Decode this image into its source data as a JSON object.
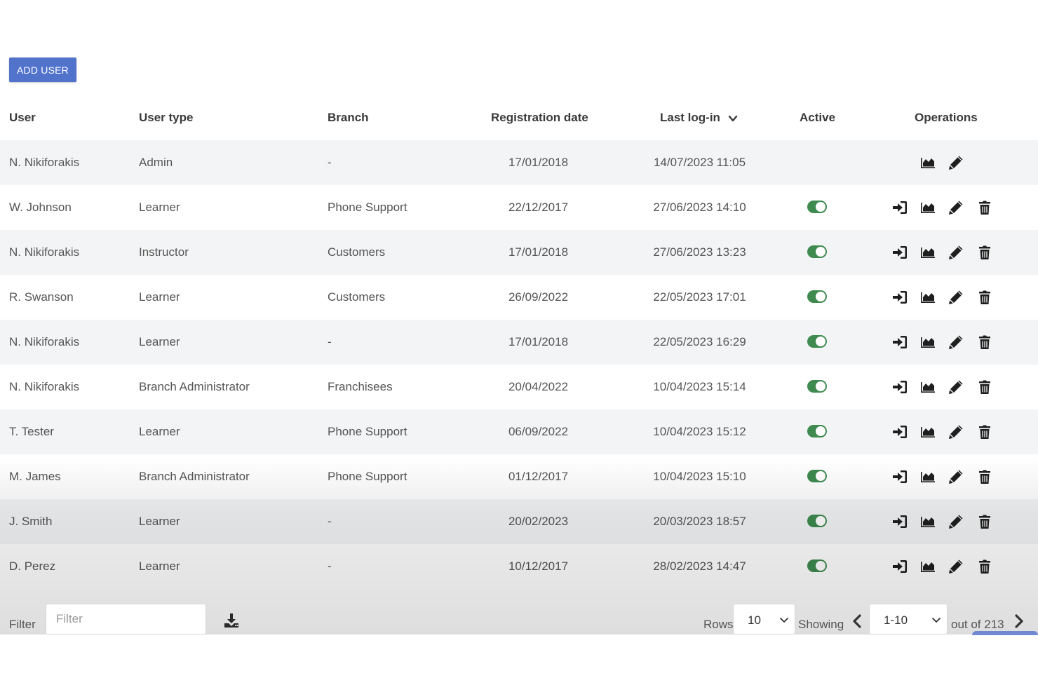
{
  "toolbar": {
    "add_user_label": "ADD USER"
  },
  "table": {
    "headers": {
      "user": "User",
      "user_type": "User type",
      "branch": "Branch",
      "registration_date": "Registration date",
      "last_login": "Last log-in",
      "active": "Active",
      "operations": "Operations"
    },
    "rows": [
      {
        "user": "N. Nikiforakis",
        "user_type": "Admin",
        "branch": "-",
        "registration_date": "17/01/2018",
        "last_login": "14/07/2023 11:05",
        "active": null,
        "operations": [
          "stats-icon",
          "edit-icon"
        ]
      },
      {
        "user": "W. Johnson",
        "user_type": "Learner",
        "branch": "Phone Support",
        "registration_date": "22/12/2017",
        "last_login": "27/06/2023 14:10",
        "active": true,
        "operations": [
          "login-as-icon",
          "stats-icon",
          "edit-icon",
          "delete-icon"
        ]
      },
      {
        "user": "N. Nikiforakis",
        "user_type": "Instructor",
        "branch": "Customers",
        "registration_date": "17/01/2018",
        "last_login": "27/06/2023 13:23",
        "active": true,
        "operations": [
          "login-as-icon",
          "stats-icon",
          "edit-icon",
          "delete-icon"
        ]
      },
      {
        "user": "R. Swanson",
        "user_type": "Learner",
        "branch": "Customers",
        "registration_date": "26/09/2022",
        "last_login": "22/05/2023 17:01",
        "active": true,
        "operations": [
          "login-as-icon",
          "stats-icon",
          "edit-icon",
          "delete-icon"
        ]
      },
      {
        "user": "N. Nikiforakis",
        "user_type": "Learner",
        "branch": "-",
        "registration_date": "17/01/2018",
        "last_login": "22/05/2023 16:29",
        "active": true,
        "operations": [
          "login-as-icon",
          "stats-icon",
          "edit-icon",
          "delete-icon"
        ]
      },
      {
        "user": "N. Nikiforakis",
        "user_type": "Branch Administrator",
        "branch": "Franchisees",
        "registration_date": "20/04/2022",
        "last_login": "10/04/2023 15:14",
        "active": true,
        "operations": [
          "login-as-icon",
          "stats-icon",
          "edit-icon",
          "delete-icon"
        ]
      },
      {
        "user": "T. Tester",
        "user_type": "Learner",
        "branch": "Phone Support",
        "registration_date": "06/09/2022",
        "last_login": "10/04/2023 15:12",
        "active": true,
        "operations": [
          "login-as-icon",
          "stats-icon",
          "edit-icon",
          "delete-icon"
        ]
      },
      {
        "user": "M. James",
        "user_type": "Branch Administrator",
        "branch": "Phone Support",
        "registration_date": "01/12/2017",
        "last_login": "10/04/2023 15:10",
        "active": true,
        "operations": [
          "login-as-icon",
          "stats-icon",
          "edit-icon",
          "delete-icon"
        ]
      },
      {
        "user": "J. Smith",
        "user_type": "Learner",
        "branch": "-",
        "registration_date": "20/02/2023",
        "last_login": "20/03/2023 18:57",
        "active": true,
        "operations": [
          "login-as-icon",
          "stats-icon",
          "edit-icon",
          "delete-icon"
        ]
      },
      {
        "user": "D. Perez",
        "user_type": "Learner",
        "branch": "-",
        "registration_date": "10/12/2017",
        "last_login": "28/02/2023 14:47",
        "active": true,
        "operations": [
          "login-as-icon",
          "stats-icon",
          "edit-icon",
          "delete-icon"
        ]
      }
    ]
  },
  "footer": {
    "filter_label": "Filter",
    "filter_placeholder": "Filter",
    "filter_value": "",
    "rows_label": "Rows",
    "rows_value": "10",
    "showing_label": "Showing",
    "showing_value": "1-10",
    "out_of_text": "out of 213"
  },
  "colors": {
    "accent": "#5273cc",
    "toggle_on": "#3e8a4f",
    "row_stripe": "#f3f4f5",
    "icon": "#1f1f1f"
  }
}
